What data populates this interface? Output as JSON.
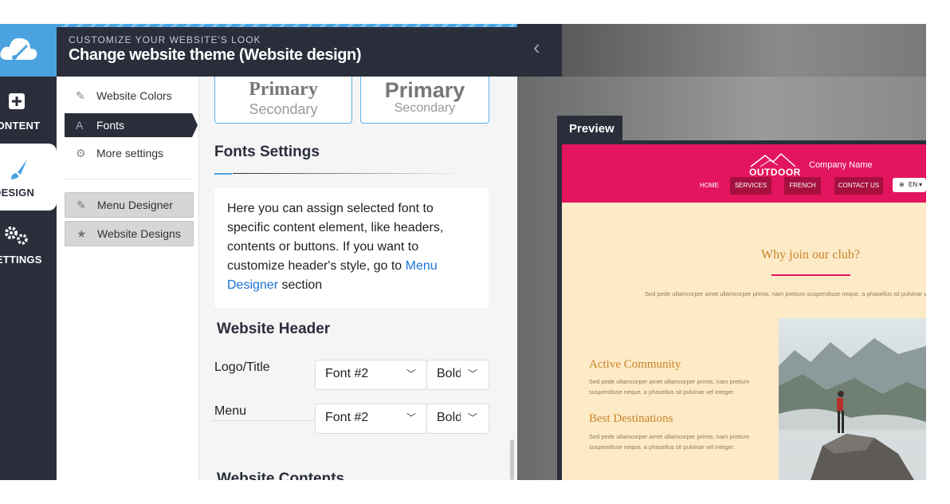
{
  "rail": {
    "items": [
      {
        "label": "CONTENT",
        "icon": "plus-square-icon"
      },
      {
        "label": "DESIGN",
        "icon": "paintbrush-icon"
      },
      {
        "label": "SETTINGS",
        "icon": "gears-icon"
      }
    ]
  },
  "header": {
    "subtitle": "CUSTOMIZE YOUR WEBSITE'S LOOK",
    "title": "Change website theme (Website design)"
  },
  "submenu": {
    "items": [
      {
        "label": "Website Colors",
        "icon": "brush-icon"
      },
      {
        "label": "Fonts",
        "icon": "font-icon"
      },
      {
        "label": "More settings",
        "icon": "gears-icon"
      }
    ],
    "buttons": [
      {
        "label": "Menu Designer",
        "icon": "pencil-icon"
      },
      {
        "label": "Website Designs",
        "icon": "star-icon"
      }
    ]
  },
  "font_cards": [
    {
      "primary": "Primary",
      "secondary": "Secondary"
    },
    {
      "primary": "Primary",
      "secondary": "Secondary"
    }
  ],
  "fonts_settings": {
    "title": "Fonts Settings",
    "info_text": "Here you can assign selected font to specific content element, like headers, contents or buttons. If you want to customize header's style, go to ",
    "info_link": "Menu Designer",
    "info_suffix": " section"
  },
  "website_header": {
    "title": "Website Header",
    "rows": [
      {
        "label": "Logo/Title",
        "font": "Font #2",
        "weight": "Bold"
      },
      {
        "label": "Menu",
        "font": "Font #2",
        "weight": "Bold"
      }
    ]
  },
  "website_contents": {
    "title": "Website Contents"
  },
  "preview": {
    "tab_label": "Preview",
    "site": {
      "brand": "OUTDOOR",
      "company": "Company Name",
      "nav": [
        "HOME",
        "SERVICES",
        "FRENCH",
        "CONTACT US"
      ],
      "lang": "EN",
      "heading": "Why join our club?",
      "lorem_center": "Sed pede ullamcorper amet ullamcorper primis, nam pretium suspendisse neque, a phasellus sit pulvinar vel integer.",
      "features": [
        {
          "title": "Active Community",
          "text": "Sed pede ullamcorper amet ullamcorper primis, nam pretium suspendisse neque, a phasellus sit pulvinar vel integer."
        },
        {
          "title": "Best Destinations",
          "text": "Sed pede ullamcorper amet ullamcorper primis, nam pretium suspendisse neque, a phasellus sit pulvinar vel integer."
        }
      ]
    }
  },
  "colors": {
    "rail": "#2a2e3b",
    "accent_blue": "#4aa3df",
    "site_nav": "#e3155e",
    "site_bg": "#fdeac6",
    "site_heading": "#c8842a"
  }
}
